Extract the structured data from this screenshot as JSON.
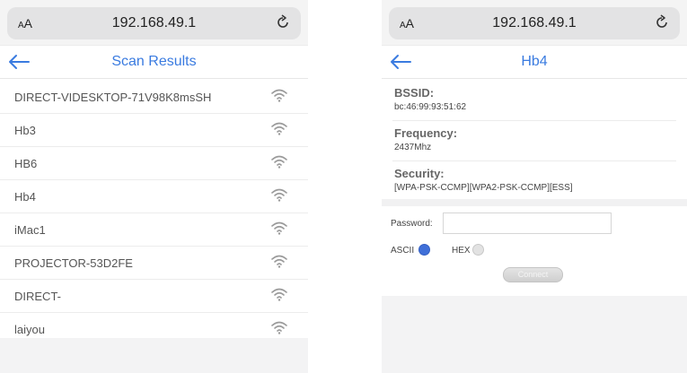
{
  "left_screen": {
    "browser": {
      "aa_label_small": "A",
      "aa_label_large": "A",
      "url": "192.168.49.1",
      "reload_icon": "reload-icon"
    },
    "header": {
      "back_icon": "back-arrow-icon",
      "title": "Scan Results"
    },
    "networks": [
      {
        "ssid": "DIRECT-VIDESKTOP-71V98K8msSH"
      },
      {
        "ssid": "Hb3"
      },
      {
        "ssid": "HB6"
      },
      {
        "ssid": "Hb4"
      },
      {
        "ssid": "iMac1"
      },
      {
        "ssid": "PROJECTOR-53D2FE"
      },
      {
        "ssid": "DIRECT-"
      },
      {
        "ssid": "laiyou"
      }
    ],
    "signal_icon": "wifi-signal-icon"
  },
  "right_screen": {
    "browser": {
      "aa_label_small": "A",
      "aa_label_large": "A",
      "url": "192.168.49.1",
      "reload_icon": "reload-icon"
    },
    "header": {
      "back_icon": "back-arrow-icon",
      "title": "Hb4"
    },
    "details": {
      "bssid_label": "BSSID:",
      "bssid_value": "bc:46:99:93:51:62",
      "frequency_label": "Frequency:",
      "frequency_value": "2437Mhz",
      "security_label": "Security:",
      "security_value": "[WPA-PSK-CCMP][WPA2-PSK-CCMP][ESS]"
    },
    "form": {
      "password_label": "Password:",
      "password_value": "",
      "ascii_label": "ASCII",
      "hex_label": "HEX",
      "selected_encoding": "ASCII",
      "connect_label": "Connect"
    }
  },
  "colors": {
    "accent": "#3a7be0",
    "radio_selected": "#3f6fd8"
  }
}
